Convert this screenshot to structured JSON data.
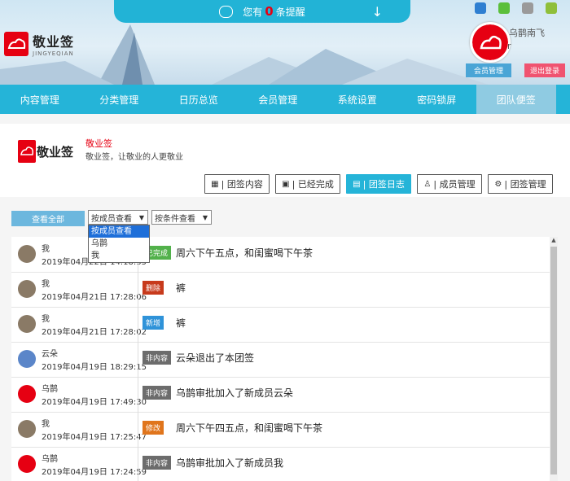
{
  "header": {
    "notice_prefix": "您有",
    "notice_count": "0",
    "notice_suffix": "条提醒",
    "logo_title": "敬业签",
    "logo_sub": "JINGYEQIAN",
    "user_name": "乌鹊南飞",
    "user_sub": "r",
    "member_btn": "会员管理",
    "logout_btn": "退出登录",
    "os_icons": [
      "ie-icon",
      "windows-icon",
      "apple-icon",
      "android-icon"
    ]
  },
  "nav": {
    "items": [
      "内容管理",
      "分类管理",
      "日历总览",
      "会员管理",
      "系统设置",
      "密码锁屏",
      "团队便签"
    ],
    "active_index": 6
  },
  "brand": {
    "logo_text": "敬业签",
    "title": "敬业签",
    "desc": "敬业签，让敬业的人更敬业"
  },
  "toolbar": {
    "buttons": [
      "| 团签内容",
      "| 已经完成",
      "| 团签日志",
      "| 成员管理",
      "| 团签管理"
    ],
    "active_index": 2
  },
  "filters": {
    "view_all": "查看全部",
    "member_select": "按成员查看",
    "condition_select": "按条件查看",
    "member_options": [
      "按成员查看",
      "乌鹊",
      "我"
    ]
  },
  "log": [
    {
      "who": "我",
      "time": "2019年04月22日 14:18:35",
      "tag": "已完成",
      "tag_color": "#52b14b",
      "msg": "周六下午五点，和闺蜜喝下午茶",
      "avatar": "#8a7a66"
    },
    {
      "who": "我",
      "time": "2019年04月21日 17:28:06",
      "tag": "删除",
      "tag_color": "#c73a1c",
      "msg": "裤",
      "avatar": "#8a7a66"
    },
    {
      "who": "我",
      "time": "2019年04月21日 17:28:02",
      "tag": "新增",
      "tag_color": "#2f93d9",
      "msg": "裤",
      "avatar": "#8a7a66"
    },
    {
      "who": "云朵",
      "time": "2019年04月19日 18:29:15",
      "tag": "非内容",
      "tag_color": "#6c6c6c",
      "msg": "云朵退出了本团签",
      "avatar": "#5b86c9"
    },
    {
      "who": "乌鹊",
      "time": "2019年04月19日 17:49:30",
      "tag": "非内容",
      "tag_color": "#6c6c6c",
      "msg": "乌鹊审批加入了新成员云朵",
      "avatar": "#e60012"
    },
    {
      "who": "我",
      "time": "2019年04月19日 17:25:47",
      "tag": "修改",
      "tag_color": "#e0751c",
      "msg": "周六下午四五点，和闺蜜喝下午茶",
      "avatar": "#8a7a66"
    },
    {
      "who": "乌鹊",
      "time": "2019年04月19日 17:24:59",
      "tag": "非内容",
      "tag_color": "#6c6c6c",
      "msg": "乌鹊审批加入了新成员我",
      "avatar": "#e60012"
    }
  ]
}
